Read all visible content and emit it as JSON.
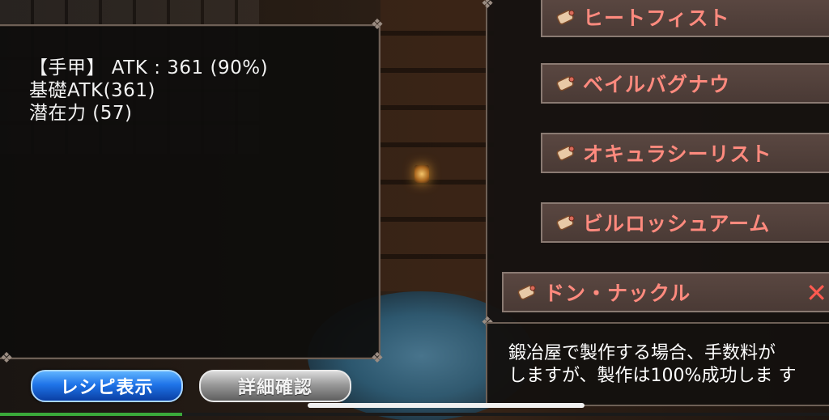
{
  "stats": {
    "line1": "【手甲】 ATK : 361 (90%)",
    "line2": "基礎ATK(361)",
    "line3": "潜在力 (57)"
  },
  "recipe_list": {
    "items": [
      {
        "label": "ヒートフィスト",
        "selected": false,
        "icon": "scroll-icon"
      },
      {
        "label": "ベイルバグナウ",
        "selected": false,
        "icon": "scroll-icon"
      },
      {
        "label": "オキュラシーリスト",
        "selected": false,
        "icon": "scroll-icon"
      },
      {
        "label": "ビルロッシュアーム",
        "selected": false,
        "icon": "scroll-icon"
      },
      {
        "label": "ドン・ナックル",
        "selected": true,
        "icon": "scroll-icon"
      }
    ],
    "close_symbol": "✕"
  },
  "description": {
    "line1": "鍛冶屋で製作する場合、手数料が",
    "line2": "しますが、製作は100%成功しま す"
  },
  "buttons": {
    "recipe_label": "レシピ表示",
    "detail_label": "詳細確認"
  },
  "colors": {
    "item_text": "#ff8a7e",
    "recipe_button": "#1f74e8",
    "detail_button": "#9a9a9a"
  },
  "progress": {
    "value": 0.22
  }
}
